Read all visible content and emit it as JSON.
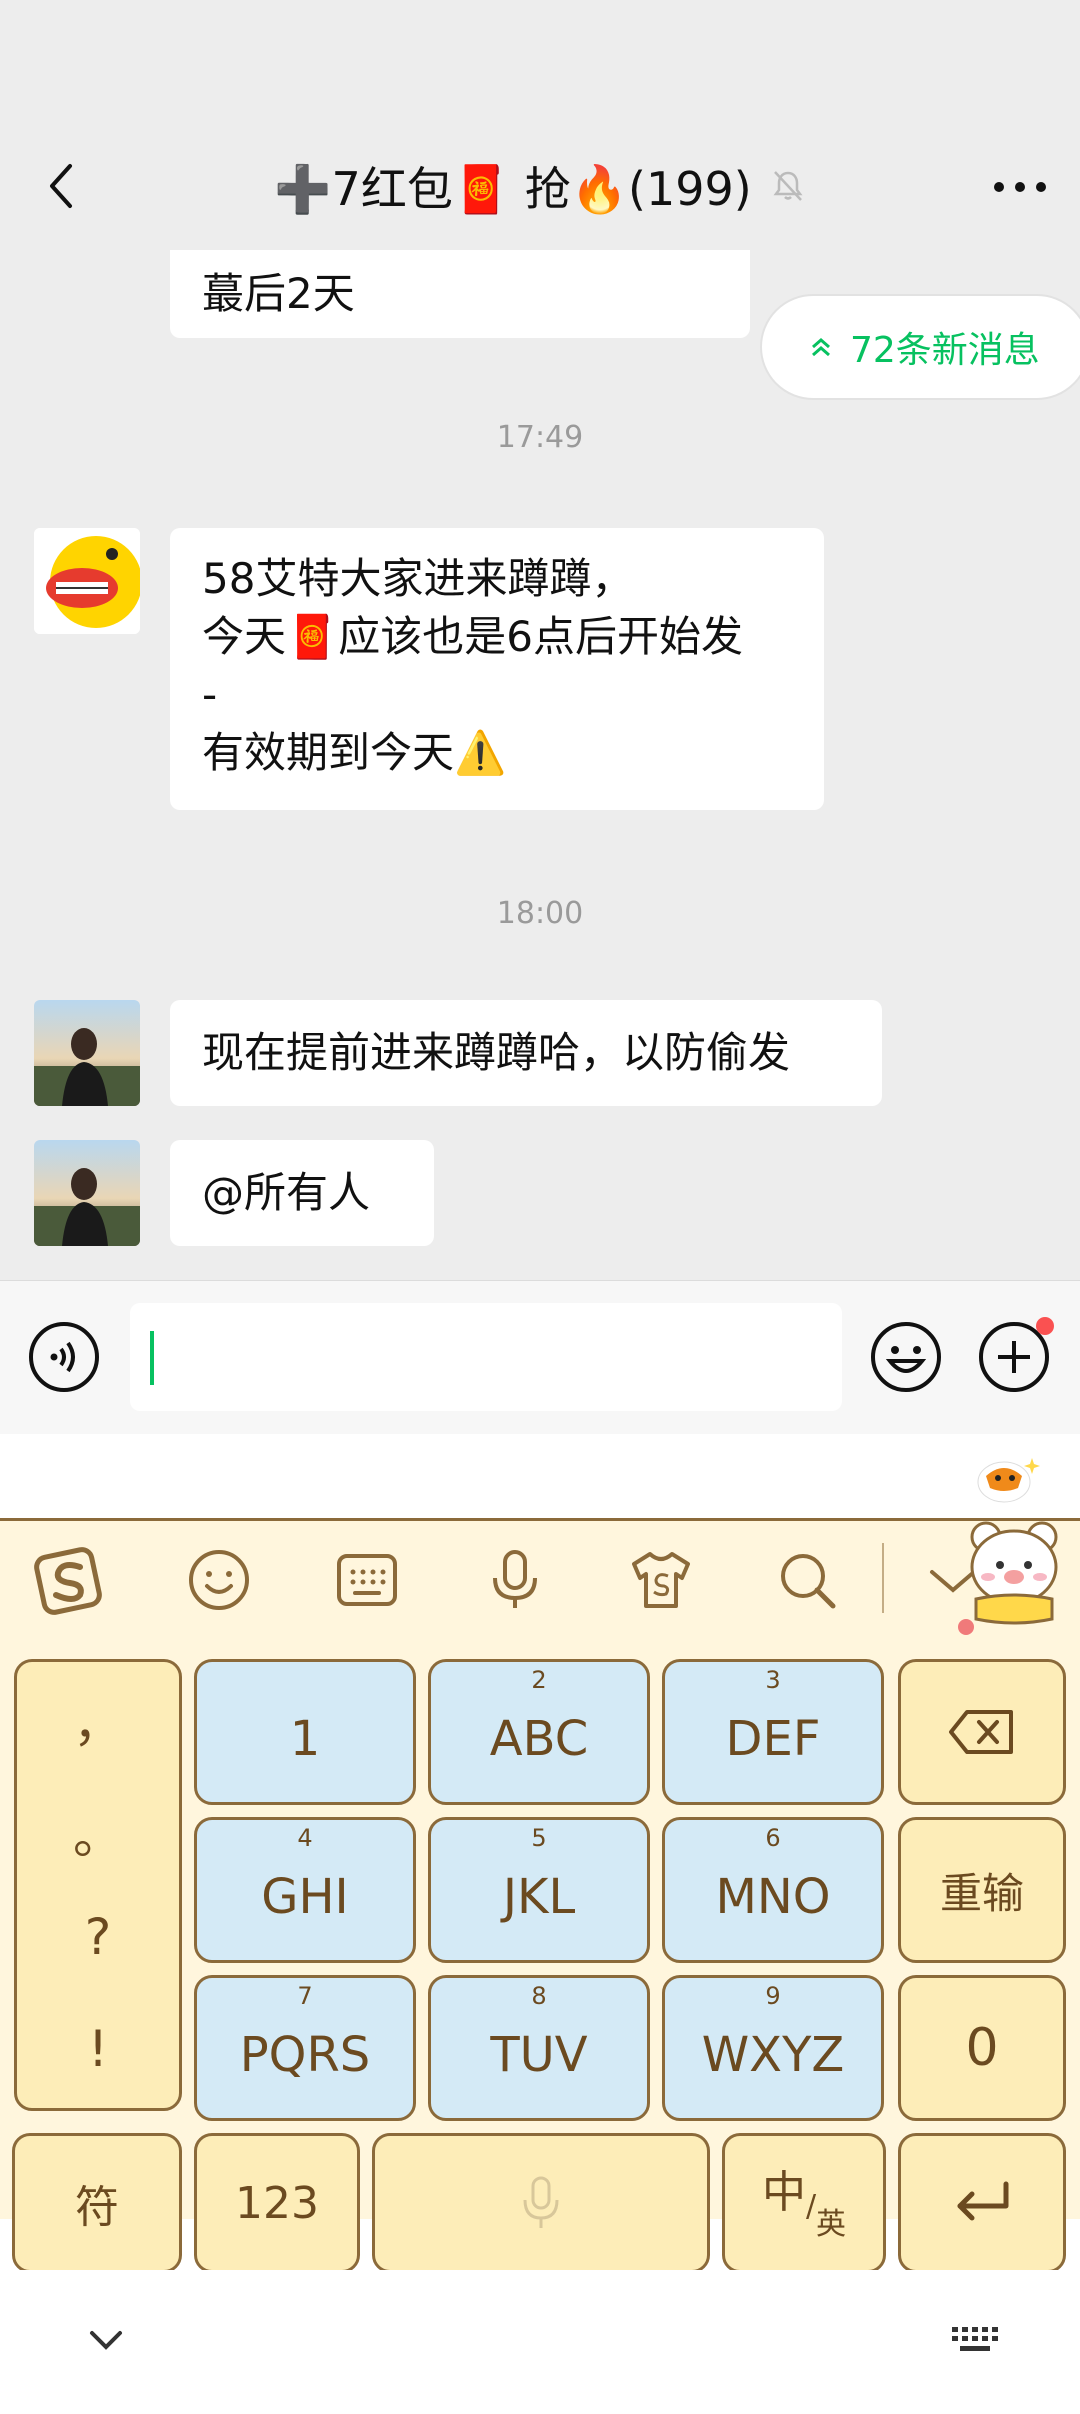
{
  "nav": {
    "title": "➕7红包🧧 抢🔥(199)",
    "back_icon": "chevron-left-icon",
    "mute_icon": "bell-off-icon",
    "more_icon": "more-dots-icon"
  },
  "chat": {
    "new_messages": "72条新消息",
    "messages": [
      {
        "text": "蕞后2天"
      },
      {
        "time": "17:49"
      },
      {
        "lines": [
          "58艾特大家进来蹲蹲，",
          "今天🧧应该也是6点后开始发",
          "-",
          "有效期到今天⚠️"
        ]
      },
      {
        "time": "18:00"
      },
      {
        "text": "现在提前进来蹲蹲哈，以防偷发"
      },
      {
        "text": "@所有人"
      }
    ]
  },
  "input": {
    "voice_icon": "voice-icon",
    "emoji_icon": "emoji-icon",
    "plus_icon": "plus-icon",
    "accent": "#07c160"
  },
  "keyboard": {
    "toolbar_icons": [
      "sogou-logo-icon",
      "smile-icon",
      "keyboard-icon",
      "microphone-icon",
      "shirt-icon",
      "search-icon",
      "collapse-icon"
    ],
    "punct": [
      "，",
      "。",
      "?",
      "!"
    ],
    "keys": [
      {
        "num": "",
        "label": "1"
      },
      {
        "num": "2",
        "label": "ABC"
      },
      {
        "num": "3",
        "label": "DEF"
      },
      {
        "num": "4",
        "label": "GHI"
      },
      {
        "num": "5",
        "label": "JKL"
      },
      {
        "num": "6",
        "label": "MNO"
      },
      {
        "num": "7",
        "label": "PQRS"
      },
      {
        "num": "8",
        "label": "TUV"
      },
      {
        "num": "9",
        "label": "WXYZ"
      }
    ],
    "right": {
      "backspace_icon": "backspace-icon",
      "reenter": "重输",
      "zero": "0"
    },
    "bottom": {
      "symbol": "符",
      "num": "123",
      "space_icon": "microphone-icon",
      "lang_main": "中",
      "lang_sub": "英",
      "enter_icon": "enter-icon"
    },
    "colors": {
      "key_blue": "#d4eaf6",
      "key_cream": "#fdedb8",
      "border": "#8b6a3a"
    }
  },
  "system_bar": {
    "collapse_icon": "chevron-down-icon",
    "keyboard_icon": "keyboard-grid-icon"
  }
}
